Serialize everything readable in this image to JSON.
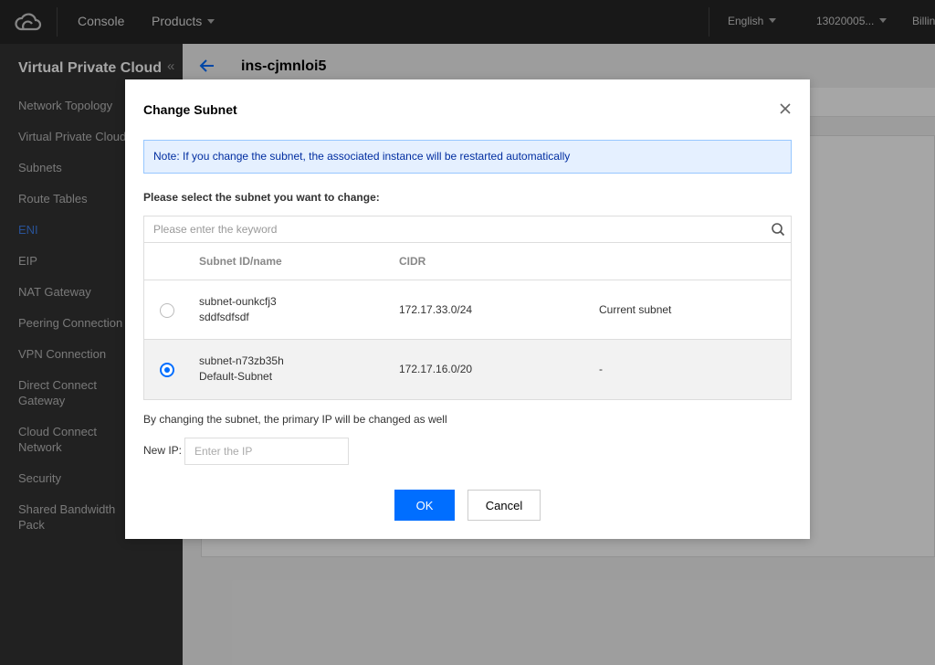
{
  "topnav": {
    "console": "Console",
    "products": "Products",
    "language": "English",
    "account": "13020005...",
    "billing": "Billin"
  },
  "sidebar": {
    "title": "Virtual Private Cloud",
    "collapse_glyph": "«",
    "items": [
      {
        "label": "Network Topology",
        "active": false
      },
      {
        "label": "Virtual Private Cloud",
        "active": false
      },
      {
        "label": "Subnets",
        "active": false
      },
      {
        "label": "Route Tables",
        "active": false
      },
      {
        "label": "ENI",
        "active": true
      },
      {
        "label": "EIP",
        "active": false
      },
      {
        "label": "NAT Gateway",
        "active": false
      },
      {
        "label": "Peering Connection",
        "active": false
      },
      {
        "label": "VPN Connection",
        "active": false
      },
      {
        "label": "Direct Connect Gateway",
        "active": false
      },
      {
        "label": "Cloud Connect Network",
        "active": false
      },
      {
        "label": "Security",
        "active": false
      },
      {
        "label": "Shared Bandwidth Pack",
        "active": false
      }
    ]
  },
  "main": {
    "instance_title": "ins-cjmnloi5"
  },
  "dialog": {
    "title": "Change Subnet",
    "note": "Note: If you change the subnet, the associated instance will be restarted automatically",
    "prompt": "Please select the subnet you want to change:",
    "search_placeholder": "Please enter the keyword",
    "columns": {
      "id_name": "Subnet ID/name",
      "cidr": "CIDR"
    },
    "rows": [
      {
        "id": "subnet-ounkcfj3",
        "name": "sddfsdfsdf",
        "cidr": "172.17.33.0/24",
        "status": "Current subnet",
        "selected": false
      },
      {
        "id": "subnet-n73zb35h",
        "name": "Default-Subnet",
        "cidr": "172.17.16.0/20",
        "status": "-",
        "selected": true
      }
    ],
    "hint": "By changing the subnet, the primary IP will be changed as well",
    "new_ip_label": "New IP:",
    "new_ip_placeholder": "Enter the IP",
    "ok_label": "OK",
    "cancel_label": "Cancel"
  },
  "colors": {
    "accent": "#006eff",
    "topnav_bg": "#262626",
    "sidebar_bg": "#333333",
    "note_bg": "#e5f0ff"
  }
}
